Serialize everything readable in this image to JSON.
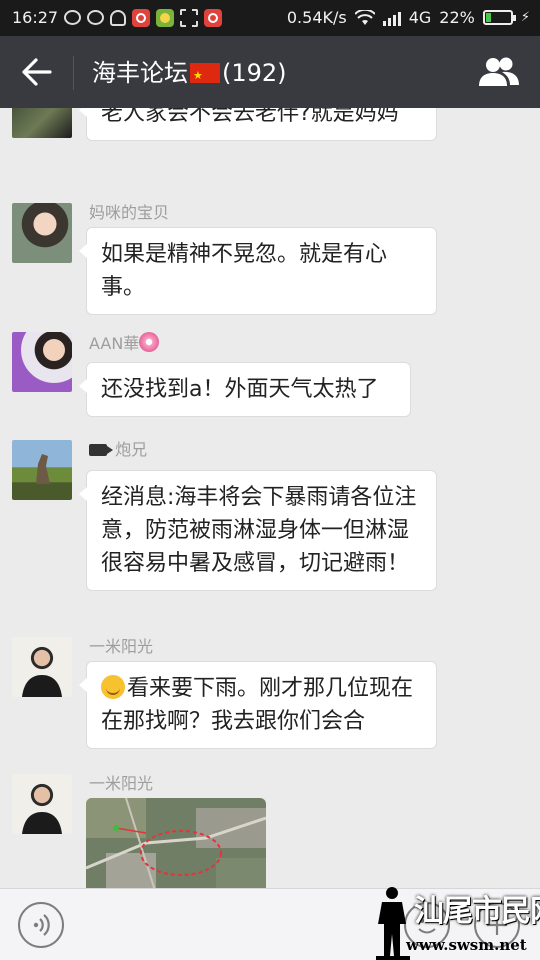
{
  "status_bar": {
    "time": "16:27",
    "net_speed": "0.54K/s",
    "network": "4G",
    "battery_percent": "22%",
    "battery_level": 0.22,
    "left_icons": [
      "wechat-icon",
      "wechat-icon",
      "lock-icon",
      "netease-music-icon",
      "app-green-icon",
      "scan-icon",
      "netease-music-icon"
    ],
    "right_icons": [
      "wifi-icon",
      "signal-icon",
      "battery-icon",
      "charging-icon"
    ]
  },
  "nav": {
    "title": "海丰论坛",
    "member_count": "(192)",
    "icons": [
      "back-arrow-icon",
      "china-flag-icon",
      "group-members-icon"
    ]
  },
  "messages": [
    {
      "sender": "",
      "text": "老人家会不会去老伴?就是妈妈"
    },
    {
      "sender": "妈咪的宝贝",
      "text": "如果是精神不晃忽。就是有心事。"
    },
    {
      "sender": "AAN華",
      "text": "还没找到a！外面天气太热了"
    },
    {
      "sender": "炮兄",
      "text": "经消息:海丰将会下暴雨请各位注意，防范被雨淋湿身体一但淋湿很容易中暑及感冒，切记避雨！"
    },
    {
      "sender": "一米阳光",
      "text": "看来要下雨。刚才那几位现在在那找啊？我去跟你们会合"
    },
    {
      "sender": "一米阳光",
      "text": ""
    }
  ],
  "input_bar": {
    "icons": [
      "voice-icon",
      "emoji-icon",
      "plus-icon"
    ]
  },
  "watermark": {
    "cn": "汕尾市民网",
    "url": "www.swsm.net"
  },
  "colors": {
    "nav_bg": "#393a3f",
    "status_bg": "#1a1a1a",
    "chat_bg": "#ebebeb",
    "bubble_bg": "#ffffff",
    "battery": "#48c848"
  }
}
